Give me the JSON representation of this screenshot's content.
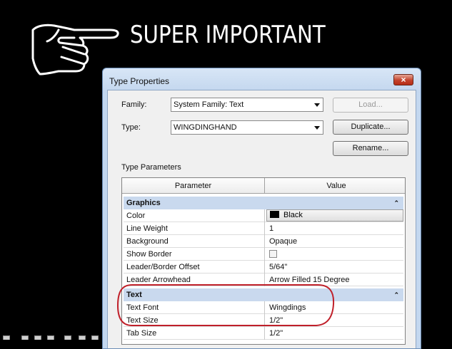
{
  "annotation": {
    "headline": "SUPER IMPORTANT",
    "hand_icon": "pointing-hand-icon",
    "highlight_color": "#c0202a"
  },
  "dialog": {
    "title": "Type Properties",
    "close_glyph": "×",
    "family_label": "Family:",
    "family_value": "System Family: Text",
    "type_label": "Type:",
    "type_value": "WINGDINGHAND",
    "load_label": "Load...",
    "duplicate_label": "Duplicate...",
    "rename_label": "Rename...",
    "section_label": "Type Parameters",
    "columns": {
      "parameter": "Parameter",
      "value": "Value"
    },
    "groups": [
      {
        "name": "Graphics",
        "chevron": "⌃",
        "rows": [
          {
            "parameter": "Color",
            "value": "Black"
          },
          {
            "parameter": "Line Weight",
            "value": "1"
          },
          {
            "parameter": "Background",
            "value": "Opaque"
          },
          {
            "parameter": "Show Border",
            "value": ""
          },
          {
            "parameter": "Leader/Border Offset",
            "value": "5/64\""
          },
          {
            "parameter": "Leader Arrowhead",
            "value": "Arrow Filled 15 Degree"
          }
        ]
      },
      {
        "name": "Text",
        "chevron": "⌃",
        "rows": [
          {
            "parameter": "Text Font",
            "value": "Wingdings"
          },
          {
            "parameter": "Text Size",
            "value": "1/2\""
          },
          {
            "parameter": "Tab Size",
            "value": "1/2\""
          }
        ]
      }
    ]
  },
  "colors": {
    "group_header": "#c9d9ee",
    "title_bar": "#c2d6ee",
    "close_button": "#c4432c",
    "swatch": "#000000"
  }
}
